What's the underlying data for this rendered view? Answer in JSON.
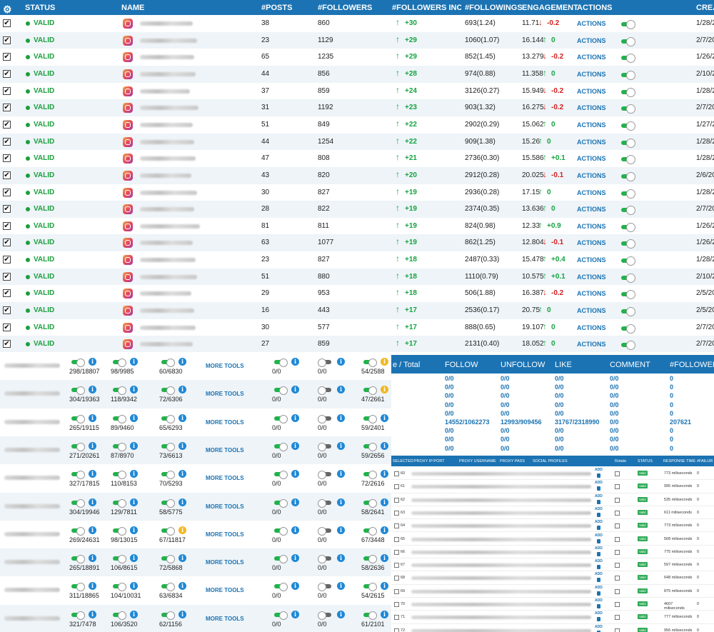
{
  "top": {
    "headers": {
      "status": "STATUS",
      "name": "NAME",
      "posts": "#POSTS",
      "followers": "#FOLLOWERS",
      "increase": "#FOLLOWERS INCREA",
      "followings": "#FOLLOWINGS",
      "engagement": "ENGAGEMENT",
      "actions": "ACTIONS",
      "created": "CREA"
    },
    "rows": [
      {
        "status": "VALID",
        "posts": "38",
        "followers": "860",
        "inc": "+30",
        "following": "693(1.24)",
        "eng": "11.71",
        "dir": "down",
        "delta": "-0.2",
        "action": "ACTIONS",
        "on": true,
        "date": "1/28/2"
      },
      {
        "status": "VALID",
        "posts": "23",
        "followers": "1129",
        "inc": "+29",
        "following": "1060(1.07)",
        "eng": "16.144",
        "dir": "up",
        "delta": "0",
        "action": "ACTIONS",
        "on": true,
        "date": "2/7/20"
      },
      {
        "status": "VALID",
        "posts": "65",
        "followers": "1235",
        "inc": "+29",
        "following": "852(1.45)",
        "eng": "13.279",
        "dir": "down",
        "delta": "-0.2",
        "action": "ACTIONS",
        "on": true,
        "date": "1/26/2"
      },
      {
        "status": "VALID",
        "posts": "44",
        "followers": "856",
        "inc": "+28",
        "following": "974(0.88)",
        "eng": "11.358",
        "dir": "up",
        "delta": "0",
        "action": "ACTIONS",
        "on": true,
        "date": "2/10/2"
      },
      {
        "status": "VALID",
        "posts": "37",
        "followers": "859",
        "inc": "+24",
        "following": "3126(0.27)",
        "eng": "15.949",
        "dir": "down",
        "delta": "-0.2",
        "action": "ACTIONS",
        "on": true,
        "date": "1/28/2"
      },
      {
        "status": "VALID",
        "posts": "31",
        "followers": "1192",
        "inc": "+23",
        "following": "903(1.32)",
        "eng": "16.275",
        "dir": "down",
        "delta": "-0.2",
        "action": "ACTIONS",
        "on": true,
        "date": "2/7/20"
      },
      {
        "status": "VALID",
        "posts": "51",
        "followers": "849",
        "inc": "+22",
        "following": "2902(0.29)",
        "eng": "15.062",
        "dir": "up",
        "delta": "0",
        "action": "ACTIONS",
        "on": true,
        "date": "1/27/2"
      },
      {
        "status": "VALID",
        "posts": "44",
        "followers": "1254",
        "inc": "+22",
        "following": "909(1.38)",
        "eng": "15.26",
        "dir": "up",
        "delta": "0",
        "action": "ACTIONS",
        "on": true,
        "date": "1/28/2"
      },
      {
        "status": "VALID",
        "posts": "47",
        "followers": "808",
        "inc": "+21",
        "following": "2736(0.30)",
        "eng": "15.586",
        "dir": "up",
        "delta": "+0.1",
        "action": "ACTIONS",
        "on": true,
        "date": "1/28/2"
      },
      {
        "status": "VALID",
        "posts": "43",
        "followers": "820",
        "inc": "+20",
        "following": "2912(0.28)",
        "eng": "20.025",
        "dir": "down",
        "delta": "-0.1",
        "action": "ACTIONS",
        "on": true,
        "date": "2/6/20"
      },
      {
        "status": "VALID",
        "posts": "30",
        "followers": "827",
        "inc": "+19",
        "following": "2936(0.28)",
        "eng": "17.15",
        "dir": "up",
        "delta": "0",
        "action": "ACTIONS",
        "on": true,
        "date": "1/28/2"
      },
      {
        "status": "VALID",
        "posts": "28",
        "followers": "822",
        "inc": "+19",
        "following": "2374(0.35)",
        "eng": "13.636",
        "dir": "up",
        "delta": "0",
        "action": "ACTIONS",
        "on": true,
        "date": "2/7/20"
      },
      {
        "status": "VALID",
        "posts": "81",
        "followers": "811",
        "inc": "+19",
        "following": "824(0.98)",
        "eng": "12.33",
        "dir": "up",
        "delta": "+0.9",
        "action": "ACTIONS",
        "on": true,
        "date": "1/26/2"
      },
      {
        "status": "VALID",
        "posts": "63",
        "followers": "1077",
        "inc": "+19",
        "following": "862(1.25)",
        "eng": "12.804",
        "dir": "down",
        "delta": "-0.1",
        "action": "ACTIONS",
        "on": true,
        "date": "1/26/2"
      },
      {
        "status": "VALID",
        "posts": "23",
        "followers": "827",
        "inc": "+18",
        "following": "2487(0.33)",
        "eng": "15.478",
        "dir": "up",
        "delta": "+0.4",
        "action": "ACTIONS",
        "on": true,
        "date": "1/28/2"
      },
      {
        "status": "VALID",
        "posts": "51",
        "followers": "880",
        "inc": "+18",
        "following": "1110(0.79)",
        "eng": "10.575",
        "dir": "up",
        "delta": "+0.1",
        "action": "ACTIONS",
        "on": true,
        "date": "2/10/2"
      },
      {
        "status": "VALID",
        "posts": "29",
        "followers": "953",
        "inc": "+18",
        "following": "506(1.88)",
        "eng": "16.387",
        "dir": "down",
        "delta": "-0.2",
        "action": "ACTIONS",
        "on": true,
        "date": "2/5/20"
      },
      {
        "status": "VALID",
        "posts": "16",
        "followers": "443",
        "inc": "+17",
        "following": "2536(0.17)",
        "eng": "20.75",
        "dir": "up",
        "delta": "0",
        "action": "ACTIONS",
        "on": true,
        "date": "2/5/20"
      },
      {
        "status": "VALID",
        "posts": "30",
        "followers": "577",
        "inc": "+17",
        "following": "888(0.65)",
        "eng": "19.107",
        "dir": "up",
        "delta": "0",
        "action": "ACTIONS",
        "on": true,
        "date": "2/7/20"
      },
      {
        "status": "VALID",
        "posts": "27",
        "followers": "859",
        "inc": "+17",
        "following": "2131(0.40)",
        "eng": "18.052",
        "dir": "up",
        "delta": "0",
        "action": "ACTIONS",
        "on": true,
        "date": "2/7/20"
      }
    ]
  },
  "tools": {
    "more_label": "MORE TOOLS",
    "rows": [
      {
        "c1": "298/18807",
        "c2": "98/9985",
        "c3": "60/6830",
        "c4": "0/0",
        "c5": "0/0",
        "c6": "54/2588",
        "w3": false,
        "w6": true
      },
      {
        "c1": "304/19363",
        "c2": "118/9342",
        "c3": "72/6306",
        "c4": "0/0",
        "c5": "0/0",
        "c6": "47/2661",
        "w3": false,
        "w6": true
      },
      {
        "c1": "265/19115",
        "c2": "89/9460",
        "c3": "65/6293",
        "c4": "0/0",
        "c5": "0/0",
        "c6": "59/2401",
        "w3": false,
        "w6": false
      },
      {
        "c1": "271/20261",
        "c2": "87/8970",
        "c3": "73/6613",
        "c4": "0/0",
        "c5": "0/0",
        "c6": "59/2656",
        "w3": false,
        "w6": false
      },
      {
        "c1": "327/17815",
        "c2": "110/8153",
        "c3": "70/5293",
        "c4": "0/0",
        "c5": "0/0",
        "c6": "72/2616",
        "w3": false,
        "w6": false
      },
      {
        "c1": "304/19946",
        "c2": "129/7811",
        "c3": "58/5775",
        "c4": "0/0",
        "c5": "0/0",
        "c6": "58/2641",
        "w3": false,
        "w6": false
      },
      {
        "c1": "269/24631",
        "c2": "98/13015",
        "c3": "67/11817",
        "c4": "0/0",
        "c5": "0/0",
        "c6": "67/3448",
        "w3": true,
        "w6": false
      },
      {
        "c1": "265/18891",
        "c2": "106/8615",
        "c3": "72/5868",
        "c4": "0/0",
        "c5": "0/0",
        "c6": "58/2636",
        "w3": false,
        "w6": false
      },
      {
        "c1": "311/18865",
        "c2": "104/10031",
        "c3": "63/6834",
        "c4": "0/0",
        "c5": "0/0",
        "c6": "54/2615",
        "w3": false,
        "w6": false
      },
      {
        "c1": "321/7478",
        "c2": "106/3520",
        "c3": "62/1156",
        "c4": "0/0",
        "c5": "0/0",
        "c6": "61/2101",
        "w3": false,
        "w6": false
      }
    ]
  },
  "summary": {
    "headers": {
      "total": "e / Total",
      "follow": "FOLLOW",
      "unfollow": "UNFOLLOW",
      "like": "LIKE",
      "comment": "COMMENT",
      "followers": "#FOLLOWERS"
    },
    "rows": [
      {
        "follow": "0/0",
        "unfollow": "0/0",
        "like": "0/0",
        "comment": "0/0",
        "followers": "0"
      },
      {
        "follow": "0/0",
        "unfollow": "0/0",
        "like": "0/0",
        "comment": "0/0",
        "followers": "0"
      },
      {
        "follow": "0/0",
        "unfollow": "0/0",
        "like": "0/0",
        "comment": "0/0",
        "followers": "0"
      },
      {
        "follow": "0/0",
        "unfollow": "0/0",
        "like": "0/0",
        "comment": "0/0",
        "followers": "0"
      },
      {
        "follow": "0/0",
        "unfollow": "0/0",
        "like": "0/0",
        "comment": "0/0",
        "followers": "0"
      },
      {
        "follow": "14552/1062273",
        "unfollow": "12993/909456",
        "like": "31767/2318990",
        "comment": "0/0",
        "followers": "207621"
      },
      {
        "follow": "0/0",
        "unfollow": "0/0",
        "like": "0/0",
        "comment": "0/0",
        "followers": "0"
      },
      {
        "follow": "0/0",
        "unfollow": "0/0",
        "like": "0/0",
        "comment": "0/0",
        "followers": "0"
      },
      {
        "follow": "0/0",
        "unfollow": "0/0",
        "like": "0/0",
        "comment": "0/0",
        "followers": "0"
      }
    ]
  },
  "proxy": {
    "headers": {
      "selected": "SELECTED",
      "ipport": "PROXY IP:PORT",
      "username": "PROXY USERNAME",
      "pass": "PROXY PASS",
      "profiles": "SOCIAL PROFILES",
      "rotate": "Rotate",
      "status": "STATUS",
      "response": "RESPONSE TIME",
      "failure": "#FAILUR"
    },
    "add_label": "ADD",
    "status_label": "Valid",
    "rows": [
      {
        "id": "60",
        "resp": "773 miliseconds",
        "fail": "0"
      },
      {
        "id": "61",
        "resp": "995 miliseconds",
        "fail": "0"
      },
      {
        "id": "62",
        "resp": "535 miliseconds",
        "fail": "0"
      },
      {
        "id": "63",
        "resp": "611 miliseconds",
        "fail": "0"
      },
      {
        "id": "64",
        "resp": "773 miliseconds",
        "fail": "0"
      },
      {
        "id": "65",
        "resp": "568 miliseconds",
        "fail": "0"
      },
      {
        "id": "66",
        "resp": "775 miliseconds",
        "fail": "0"
      },
      {
        "id": "67",
        "resp": "597 miliseconds",
        "fail": "0"
      },
      {
        "id": "68",
        "resp": "648 miliseconds",
        "fail": "0"
      },
      {
        "id": "69",
        "resp": "875 miliseconds",
        "fail": "0"
      },
      {
        "id": "70",
        "resp": "4607 miliseconds",
        "fail": "0"
      },
      {
        "id": "71",
        "resp": "777 miliseconds",
        "fail": "0"
      },
      {
        "id": "72",
        "resp": "956 miliseconds",
        "fail": "0"
      }
    ]
  }
}
